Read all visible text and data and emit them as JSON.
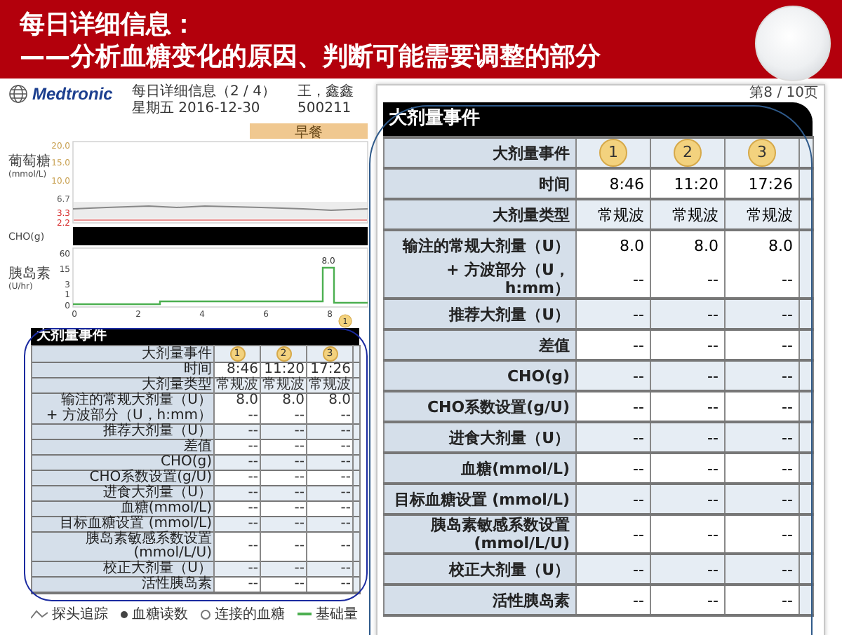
{
  "header": {
    "title_lines": [
      "每日详细信息：",
      "——分析血糖变化的原因、判断可能需要调整的部分"
    ]
  },
  "report": {
    "brand": "Medtronic",
    "title": "每日详细信息（2 / 4）",
    "date": "星期五 2016-12-30",
    "patient_name": "王，鑫鑫",
    "patient_id": "500211",
    "chart": {
      "meal_label": "早餐",
      "glucose_axis": {
        "name": "葡萄糖",
        "unit": "(mmol/L)"
      },
      "glucose_ticks": [
        {
          "label": "20.0",
          "color": "#c8a050"
        },
        {
          "label": "15.0",
          "color": "#c8a050"
        },
        {
          "label": "10.0",
          "color": "#c8a050"
        },
        {
          "label": "6.7",
          "color": "#666666"
        },
        {
          "label": "3.3",
          "color": "#d83030"
        },
        {
          "label": "2.2",
          "color": "#d83030"
        }
      ],
      "cho_label": "CHO(g)",
      "insulin_axis": {
        "name": "胰岛素",
        "unit": "(U/hr)"
      },
      "insulin_ticks": [
        "60",
        "15",
        "3",
        "1",
        "0"
      ],
      "x_ticks": [
        "0",
        "2",
        "4",
        "6",
        "8"
      ],
      "spike_label": "8.0",
      "event_marker": "1"
    },
    "bolus_table": {
      "title": "大剂量事件",
      "rows": [
        {
          "kind": "badge",
          "label": "大剂量事件",
          "values": [
            "1",
            "2",
            "3"
          ]
        },
        {
          "kind": "main",
          "label": "时间",
          "values": [
            "8:46",
            "11:20",
            "17:26"
          ]
        },
        {
          "kind": "main",
          "label": "大剂量类型",
          "values": [
            "常规波",
            "常规波",
            "常规波"
          ]
        },
        {
          "kind": "main",
          "label": "输注的常规大剂量（U）",
          "values": [
            "8.0",
            "8.0",
            "8.0"
          ]
        },
        {
          "kind": "sub",
          "label": "+ 方波部分（U，h:mm）",
          "values": [
            "--",
            "--",
            "--"
          ]
        },
        {
          "kind": "main",
          "label": "推荐大剂量（U）",
          "values": [
            "--",
            "--",
            "--"
          ]
        },
        {
          "kind": "main",
          "label": "差值",
          "values": [
            "--",
            "--",
            "--"
          ]
        },
        {
          "kind": "main",
          "label": "CHO(g)",
          "values": [
            "--",
            "--",
            "--"
          ]
        },
        {
          "kind": "main",
          "label": "CHO系数设置(g/U)",
          "values": [
            "--",
            "--",
            "--"
          ]
        },
        {
          "kind": "main",
          "label": "进食大剂量（U）",
          "values": [
            "--",
            "--",
            "--"
          ]
        },
        {
          "kind": "main",
          "label": "血糖(mmol/L)",
          "values": [
            "--",
            "--",
            "--"
          ]
        },
        {
          "kind": "main",
          "label": "目标血糖设置 (mmol/L)",
          "values": [
            "--",
            "--",
            "--"
          ]
        },
        {
          "kind": "main",
          "label": "胰岛素敏感系数设置(mmol/L/U)",
          "values": [
            "--",
            "--",
            "--"
          ]
        },
        {
          "kind": "main",
          "label": "校正大剂量（U）",
          "values": [
            "--",
            "--",
            "--"
          ]
        },
        {
          "kind": "main",
          "label": "活性胰岛素",
          "values": [
            "--",
            "--",
            "--"
          ]
        }
      ]
    },
    "legend": [
      {
        "kind": "trace",
        "label": "探头追踪"
      },
      {
        "kind": "dot",
        "label": "血糖读数"
      },
      {
        "kind": "cgt",
        "label": "连接的血糖"
      },
      {
        "kind": "line",
        "label": "基础量"
      }
    ]
  },
  "zoomed_table": {
    "page_label": "第8 / 10页",
    "title": "大剂量事件",
    "rows": [
      {
        "kind": "badge",
        "label": "大剂量事件",
        "values": [
          "1",
          "2",
          "3"
        ]
      },
      {
        "kind": "main",
        "label": "时间",
        "values": [
          "8:46",
          "11:20",
          "17:26"
        ]
      },
      {
        "kind": "main",
        "label": "大剂量类型",
        "values": [
          "常规波",
          "常规波",
          "常规波"
        ]
      },
      {
        "kind": "main",
        "label": "输注的常规大剂量（U）",
        "values": [
          "8.0",
          "8.0",
          "8.0"
        ]
      },
      {
        "kind": "sub",
        "label": "+ 方波部分（U，h:mm）",
        "values": [
          "--",
          "--",
          "--"
        ]
      },
      {
        "kind": "main",
        "label": "推荐大剂量（U）",
        "values": [
          "--",
          "--",
          "--"
        ]
      },
      {
        "kind": "main",
        "label": "差值",
        "values": [
          "--",
          "--",
          "--"
        ]
      },
      {
        "kind": "main",
        "label": "CHO(g)",
        "values": [
          "--",
          "--",
          "--"
        ]
      },
      {
        "kind": "main",
        "label": "CHO系数设置(g/U)",
        "values": [
          "--",
          "--",
          "--"
        ]
      },
      {
        "kind": "main",
        "label": "进食大剂量（U）",
        "values": [
          "--",
          "--",
          "--"
        ]
      },
      {
        "kind": "main",
        "label": "血糖(mmol/L)",
        "values": [
          "--",
          "--",
          "--"
        ]
      },
      {
        "kind": "main",
        "label": "目标血糖设置 (mmol/L)",
        "values": [
          "--",
          "--",
          "--"
        ]
      },
      {
        "kind": "main",
        "label": "胰岛素敏感系数设置(mmol/L/U)",
        "values": [
          "--",
          "--",
          "--"
        ]
      },
      {
        "kind": "main",
        "label": "校正大剂量（U）",
        "values": [
          "--",
          "--",
          "--"
        ]
      },
      {
        "kind": "main",
        "label": "活性胰岛素",
        "values": [
          "--",
          "--",
          "--"
        ]
      }
    ]
  }
}
